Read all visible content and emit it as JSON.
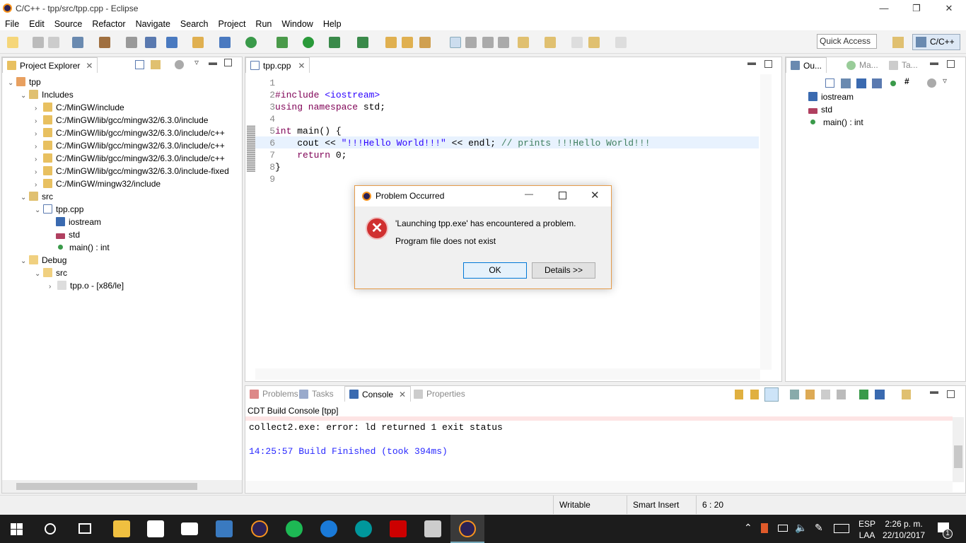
{
  "window": {
    "title": "C/C++ - tpp/src/tpp.cpp - Eclipse"
  },
  "menu": [
    "File",
    "Edit",
    "Source",
    "Refactor",
    "Navigate",
    "Search",
    "Project",
    "Run",
    "Window",
    "Help"
  ],
  "toolbar": {
    "quick_access": "Quick Access",
    "perspective": "C/C++"
  },
  "project_explorer": {
    "title": "Project Explorer",
    "items": [
      {
        "label": "tpp",
        "icon": "project-icon"
      },
      {
        "label": "Includes",
        "icon": "includes-icon"
      },
      {
        "label": "C:/MinGW/include",
        "icon": "include-folder-icon"
      },
      {
        "label": "C:/MinGW/lib/gcc/mingw32/6.3.0/include",
        "icon": "include-folder-icon"
      },
      {
        "label": "C:/MinGW/lib/gcc/mingw32/6.3.0/include/c++",
        "icon": "include-folder-icon"
      },
      {
        "label": "C:/MinGW/lib/gcc/mingw32/6.3.0/include/c++",
        "icon": "include-folder-icon"
      },
      {
        "label": "C:/MinGW/lib/gcc/mingw32/6.3.0/include/c++",
        "icon": "include-folder-icon"
      },
      {
        "label": "C:/MinGW/lib/gcc/mingw32/6.3.0/include-fixed",
        "icon": "include-folder-icon"
      },
      {
        "label": "C:/MinGW/mingw32/include",
        "icon": "include-folder-icon"
      },
      {
        "label": "src",
        "icon": "source-folder-icon"
      },
      {
        "label": "tpp.cpp",
        "icon": "cpp-file-icon"
      },
      {
        "label": "iostream",
        "icon": "include-icon"
      },
      {
        "label": "std",
        "icon": "namespace-icon"
      },
      {
        "label": "main() : int",
        "icon": "function-icon"
      },
      {
        "label": "Debug",
        "icon": "folder-icon"
      },
      {
        "label": "src",
        "icon": "folder-icon"
      },
      {
        "label": "tpp.o - [x86/le]",
        "icon": "object-file-icon"
      }
    ]
  },
  "editor": {
    "tab": "tpp.cpp",
    "lines": [
      {
        "n": "1",
        "parts": []
      },
      {
        "n": "2",
        "parts": [
          {
            "c": "kw",
            "t": "#include "
          },
          {
            "c": "str",
            "t": "<iostream>"
          }
        ]
      },
      {
        "n": "3",
        "parts": [
          {
            "c": "kw",
            "t": "using namespace "
          },
          {
            "c": "",
            "t": "std;"
          }
        ]
      },
      {
        "n": "4",
        "parts": []
      },
      {
        "n": "5",
        "parts": [
          {
            "c": "kw",
            "t": "int "
          },
          {
            "c": "",
            "t": "main() {"
          }
        ]
      },
      {
        "n": "6",
        "parts": [
          {
            "c": "",
            "t": "    cout << "
          },
          {
            "c": "str",
            "t": "\"!!!Hello World!!!\""
          },
          {
            "c": "",
            "t": " << endl; "
          },
          {
            "c": "cm",
            "t": "// prints !!!Hello World!!!"
          }
        ]
      },
      {
        "n": "7",
        "parts": [
          {
            "c": "",
            "t": "    "
          },
          {
            "c": "kw",
            "t": "return "
          },
          {
            "c": "",
            "t": "0;"
          }
        ]
      },
      {
        "n": "8",
        "parts": [
          {
            "c": "",
            "t": "}"
          }
        ]
      },
      {
        "n": "9",
        "parts": []
      }
    ]
  },
  "outline": {
    "tabs": [
      "Ou...",
      "Ma...",
      "Ta..."
    ],
    "items": [
      "iostream",
      "std",
      "main() : int"
    ]
  },
  "console": {
    "tabs": [
      "Problems",
      "Tasks",
      "Console",
      "Properties"
    ],
    "header": "CDT Build Console [tpp]",
    "lines": [
      "collect2.exe: error: ld returned 1 exit status",
      "",
      "14:25:57 Build Finished (took 394ms)"
    ]
  },
  "dialog": {
    "title": "Problem Occurred",
    "message": "'Launching tpp.exe' has encountered a problem.",
    "detail": "Program file does not exist",
    "ok": "OK",
    "details": "Details >>"
  },
  "status": {
    "writable": "Writable",
    "insert": "Smart Insert",
    "position": "6 : 20"
  },
  "taskbar": {
    "lang1": "ESP",
    "lang2": "LAA",
    "time": "2:26 p. m.",
    "date": "22/10/2017",
    "notifications": "1"
  },
  "colors": {
    "accent": "#e59b4a",
    "link_blue": "#2a00ff"
  }
}
